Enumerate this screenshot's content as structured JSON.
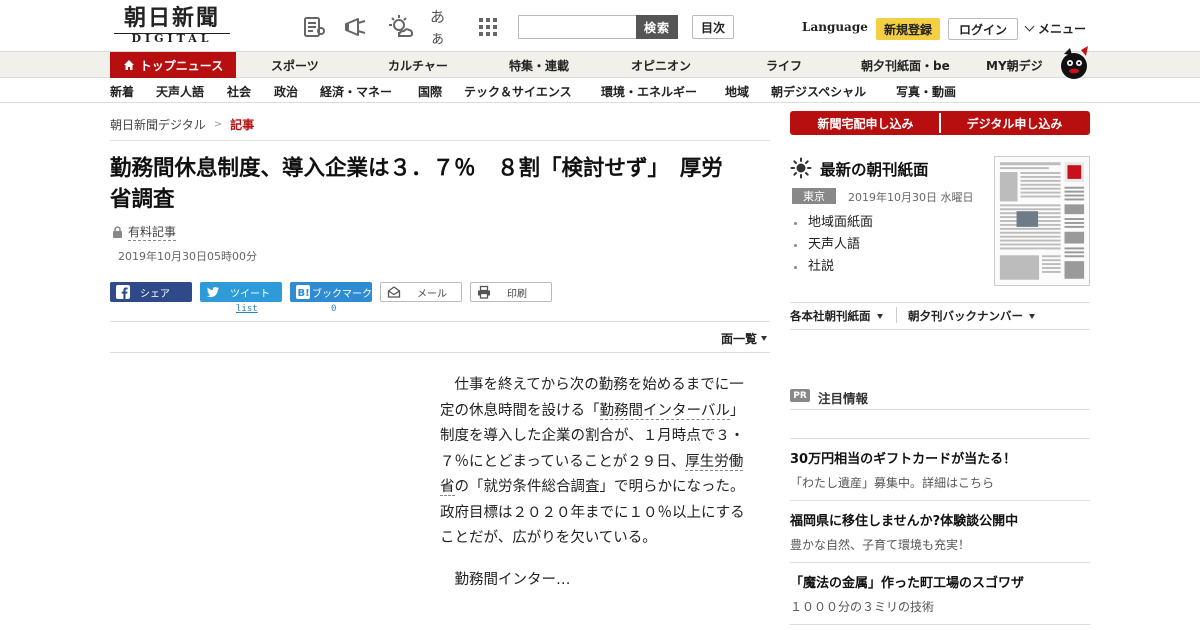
{
  "header": {
    "logo_main": "朝日新聞",
    "logo_sub": "DIGITAL",
    "font_size_icon_label": "あぁ",
    "search_placeholder": "",
    "search_button": "検索",
    "index_button": "目次",
    "language": "Language",
    "register": "新規登録",
    "login": "ログイン",
    "menu": "メニュー"
  },
  "nav_primary": [
    "トップニュース",
    "スポーツ",
    "カルチャー",
    "特集・連載",
    "オピニオン",
    "ライフ",
    "朝夕刊紙面・be",
    "MY朝デジ"
  ],
  "nav_secondary": [
    "新着",
    "天声人語",
    "社会",
    "政治",
    "経済・マネー",
    "国際",
    "テック＆サイエンス",
    "環境・エネルギー",
    "地域",
    "朝デジスペシャル",
    "写真・動画"
  ],
  "breadcrumb": {
    "home": "朝日新聞デジタル",
    "separator": ">",
    "current": "記事"
  },
  "article": {
    "title": "勤務間休息制度、導入企業は３．７％　８割「検討せず」　厚労省調査",
    "paid_label": "有料記事",
    "date": "2019年10月30日05時00分",
    "share": {
      "facebook": "シェア",
      "twitter": "ツイート",
      "twitter_count": "list",
      "hatena": "ブックマーク",
      "hatena_count": "0",
      "mail": "メール",
      "print": "印刷"
    },
    "page_list": "面一覧",
    "body": {
      "p1_a": "仕事を終えてから次の勤務を始めるまでに一定の休息時間を設ける「",
      "p1_kw1": "勤務間インターバル",
      "p1_b": "」制度を導入した企業の割合が、１月時点で３・７％にとどまっていることが２９日、",
      "p1_kw2": "厚生労働省",
      "p1_c": "の「就労条件総合調査」で明らかになった。政府目標は２０２０年までに１０％以上にすることだが、広がりを欠いている。",
      "p2": "勤務間インター…"
    }
  },
  "sidebar": {
    "subscribe_paper": "新聞宅配申し込み",
    "subscribe_digital": "デジタル申し込み",
    "paper_title": "最新の朝刊紙面",
    "edition": "東京",
    "paper_date": "2019年10月30日 水曜日",
    "paper_links": [
      "地域面紙面",
      "天声人語",
      "社説"
    ],
    "dropdown_branch": "各本社朝刊紙面",
    "dropdown_backnumber": "朝夕刊バックナンバー",
    "pr_badge": "PR",
    "pr_title": "注目情報",
    "pr_items": [
      {
        "headline": "30万円相当のギフトカードが当たる！",
        "sub": "「わたし遺産」募集中。詳細はこちら"
      },
      {
        "headline": "福岡県に移住しませんか?体験談公開中",
        "sub": "豊かな自然、子育て環境も充実！"
      },
      {
        "headline": "「魔法の金属」作った町工場のスゴワザ",
        "sub": "１０００分の３ミリの技術"
      }
    ]
  },
  "colors": {
    "brand_red": "#b70f0f",
    "register_yellow": "#f5cf42",
    "facebook": "#2f4a8a",
    "twitter": "#2e9bd9",
    "hatena": "#2f8bd2"
  }
}
